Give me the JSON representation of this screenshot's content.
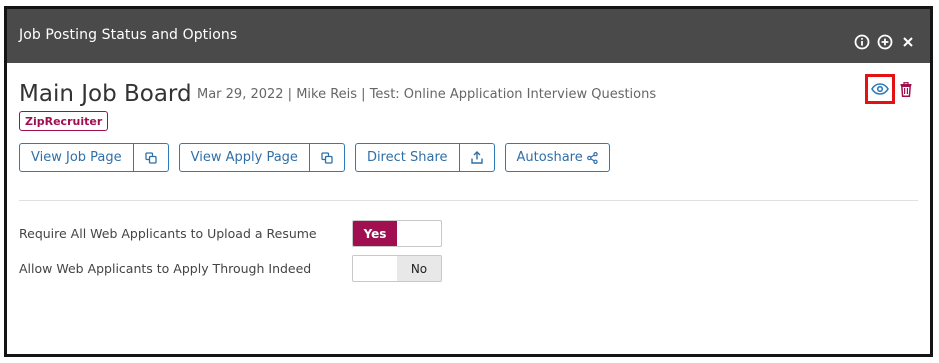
{
  "dialog": {
    "title": "Job Posting Status and Options",
    "icons": [
      "info-icon",
      "add-icon",
      "close-icon"
    ]
  },
  "job": {
    "title": "Main Job Board",
    "meta": "Mar 29, 2022 | Mike Reis | Test: Online Application Interview Questions",
    "tag": "ZipRecruiter"
  },
  "actions": {
    "view_job_page": "View Job Page",
    "view_apply_page": "View Apply Page",
    "direct_share": "Direct Share",
    "autoshare": "Autoshare"
  },
  "options": [
    {
      "label": "Require All Web Applicants to Upload a Resume",
      "value": "Yes"
    },
    {
      "label": "Allow Web Applicants to Apply Through Indeed",
      "value": "No"
    }
  ],
  "colors": {
    "header_bg": "#4a4a4a",
    "brand": "#a01050",
    "link": "#2f6fa8",
    "highlight": "#e31111"
  }
}
